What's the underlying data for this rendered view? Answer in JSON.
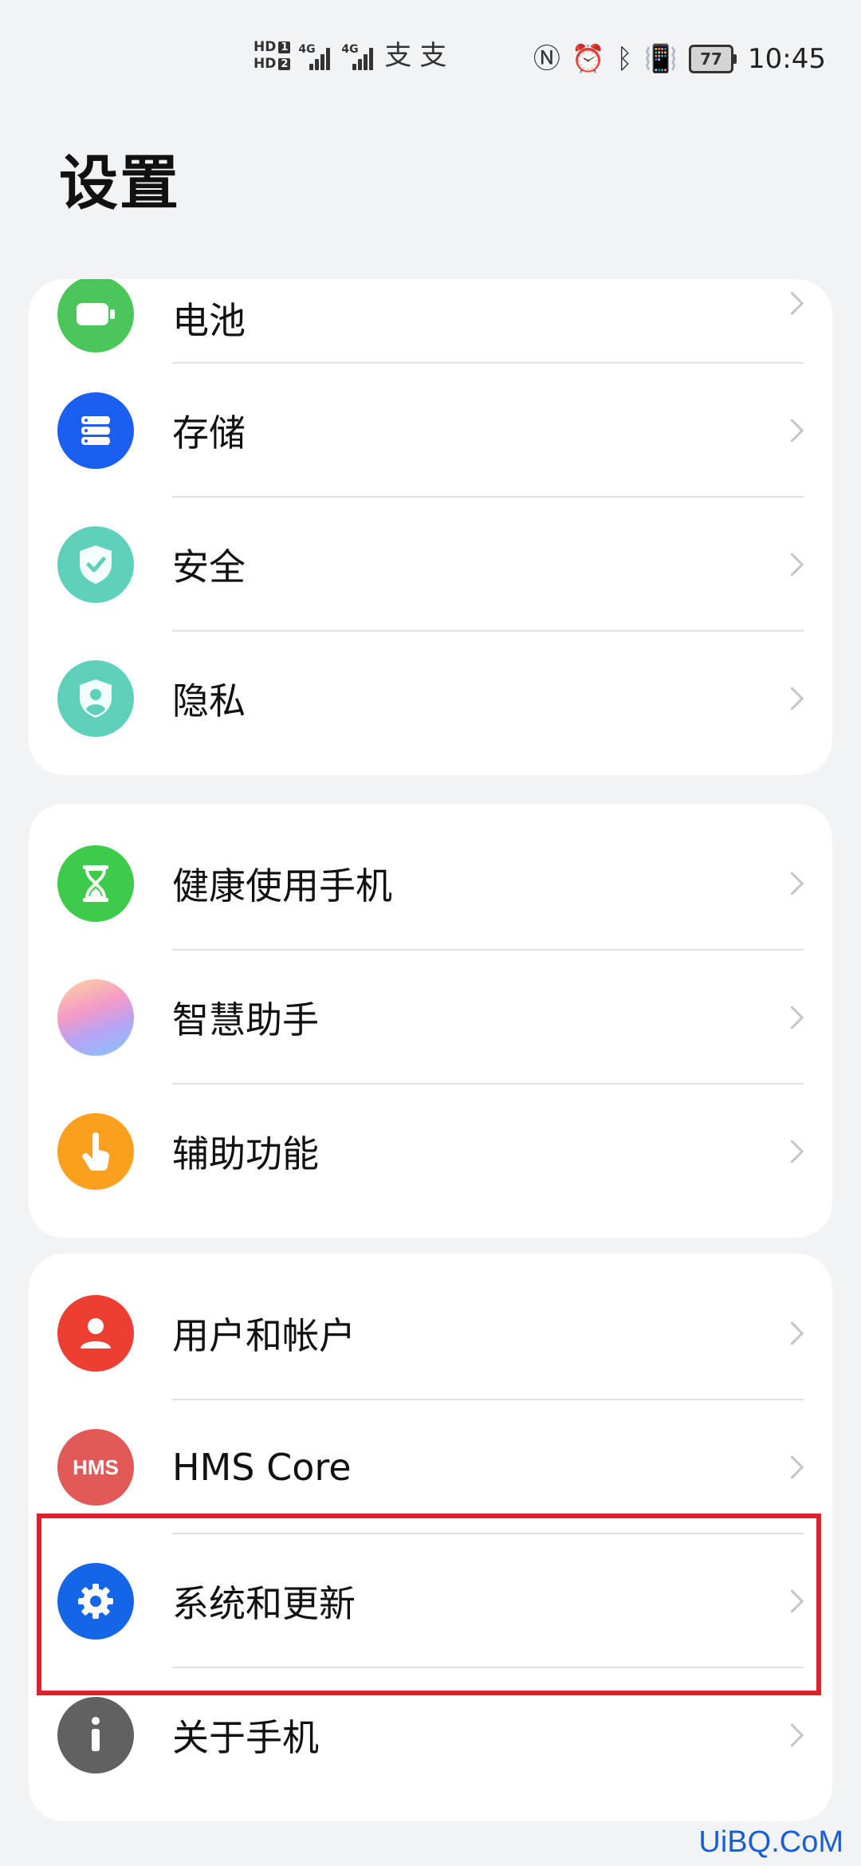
{
  "status_bar": {
    "hd1": "HD",
    "hd1_num": "1",
    "hd2": "HD",
    "hd2_num": "2",
    "net1": "4G",
    "net2": "4G",
    "battery": "77",
    "time": "10:45"
  },
  "page": {
    "title": "设置"
  },
  "groups": [
    {
      "items": [
        {
          "label": "电池",
          "icon": "battery-icon",
          "color": "#4cc55a"
        },
        {
          "label": "存储",
          "icon": "storage-icon",
          "color": "#1a5ff0"
        },
        {
          "label": "安全",
          "icon": "shield-check-icon",
          "color": "#5fd0b9"
        },
        {
          "label": "隐私",
          "icon": "privacy-icon",
          "color": "#5fd0b9"
        }
      ]
    },
    {
      "items": [
        {
          "label": "健康使用手机",
          "icon": "hourglass-icon",
          "color": "#3ecb4b"
        },
        {
          "label": "智慧助手",
          "icon": "assistant-icon",
          "color": "#f3a0c8"
        },
        {
          "label": "辅助功能",
          "icon": "hand-icon",
          "color": "#fb9f1f"
        }
      ]
    },
    {
      "items": [
        {
          "label": "用户和帐户",
          "icon": "user-icon",
          "color": "#ec3e32"
        },
        {
          "label": "HMS Core",
          "icon": "hms-icon",
          "color": "#e25a58",
          "icon_text": "HMS"
        },
        {
          "label": "系统和更新",
          "icon": "gear-icon",
          "color": "#1565e8"
        },
        {
          "label": "关于手机",
          "icon": "info-icon",
          "color": "#616161"
        }
      ]
    }
  ],
  "watermark": "UiBQ.CoM"
}
